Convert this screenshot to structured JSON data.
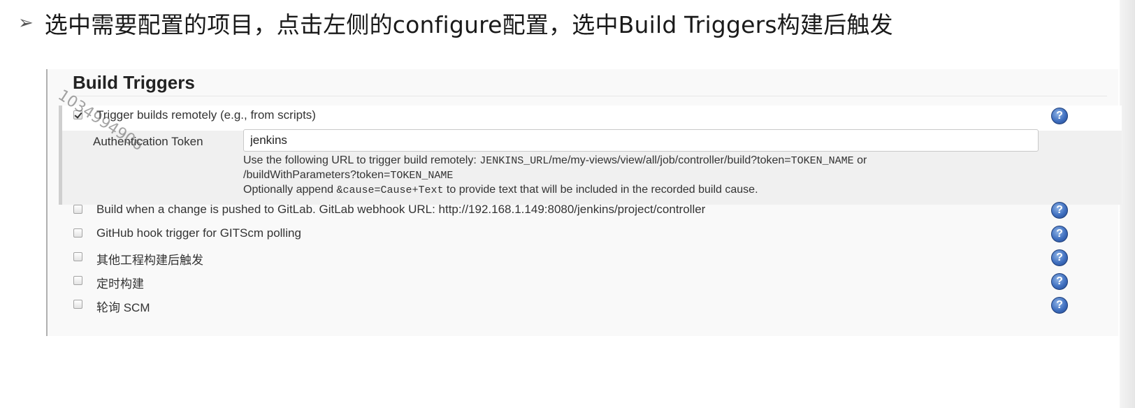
{
  "slide": {
    "bullet": "➢",
    "title": "选中需要配置的项目，点击左侧的configure配置，选中Build Triggers构建后触发"
  },
  "section": {
    "title": "Build Triggers"
  },
  "triggers": [
    {
      "label": "Trigger builds remotely (e.g., from scripts)",
      "checked": true
    },
    {
      "label": "Build when a change is pushed to GitLab. GitLab webhook URL: http://192.168.1.149:8080/jenkins/project/controller",
      "checked": false
    },
    {
      "label": "GitHub hook trigger for GITScm polling",
      "checked": false
    },
    {
      "label": "其他工程构建后触发",
      "checked": false
    },
    {
      "label": "定时构建",
      "checked": false
    },
    {
      "label": "轮询 SCM",
      "checked": false
    }
  ],
  "auth": {
    "label": "Authentication Token",
    "value": "jenkins",
    "help_line1_prefix": "Use the following URL to trigger build remotely: ",
    "help_line1_mono1": "JENKINS_URL",
    "help_line1_mid": "/me/my-views/view/all/job/controller/build?token=",
    "help_line1_mono2": "TOKEN_NAME",
    "help_line1_suffix": " or",
    "help_line2_prefix": "/buildWithParameters?token=",
    "help_line2_mono": "TOKEN_NAME",
    "help_line3_prefix": "Optionally append ",
    "help_line3_mono": "&cause=Cause+Text",
    "help_line3_suffix": " to provide text that will be included in the recorded build cause."
  },
  "help_icon_glyph": "?",
  "icons": {
    "help": "help-question-icon",
    "checkbox": "checkbox-icon"
  },
  "watermark": "1034994906",
  "colors": {
    "help_icon": "#3f6fbf",
    "panel_bg": "#f9f9f9",
    "expanded_bg": "#f0f0f0"
  }
}
